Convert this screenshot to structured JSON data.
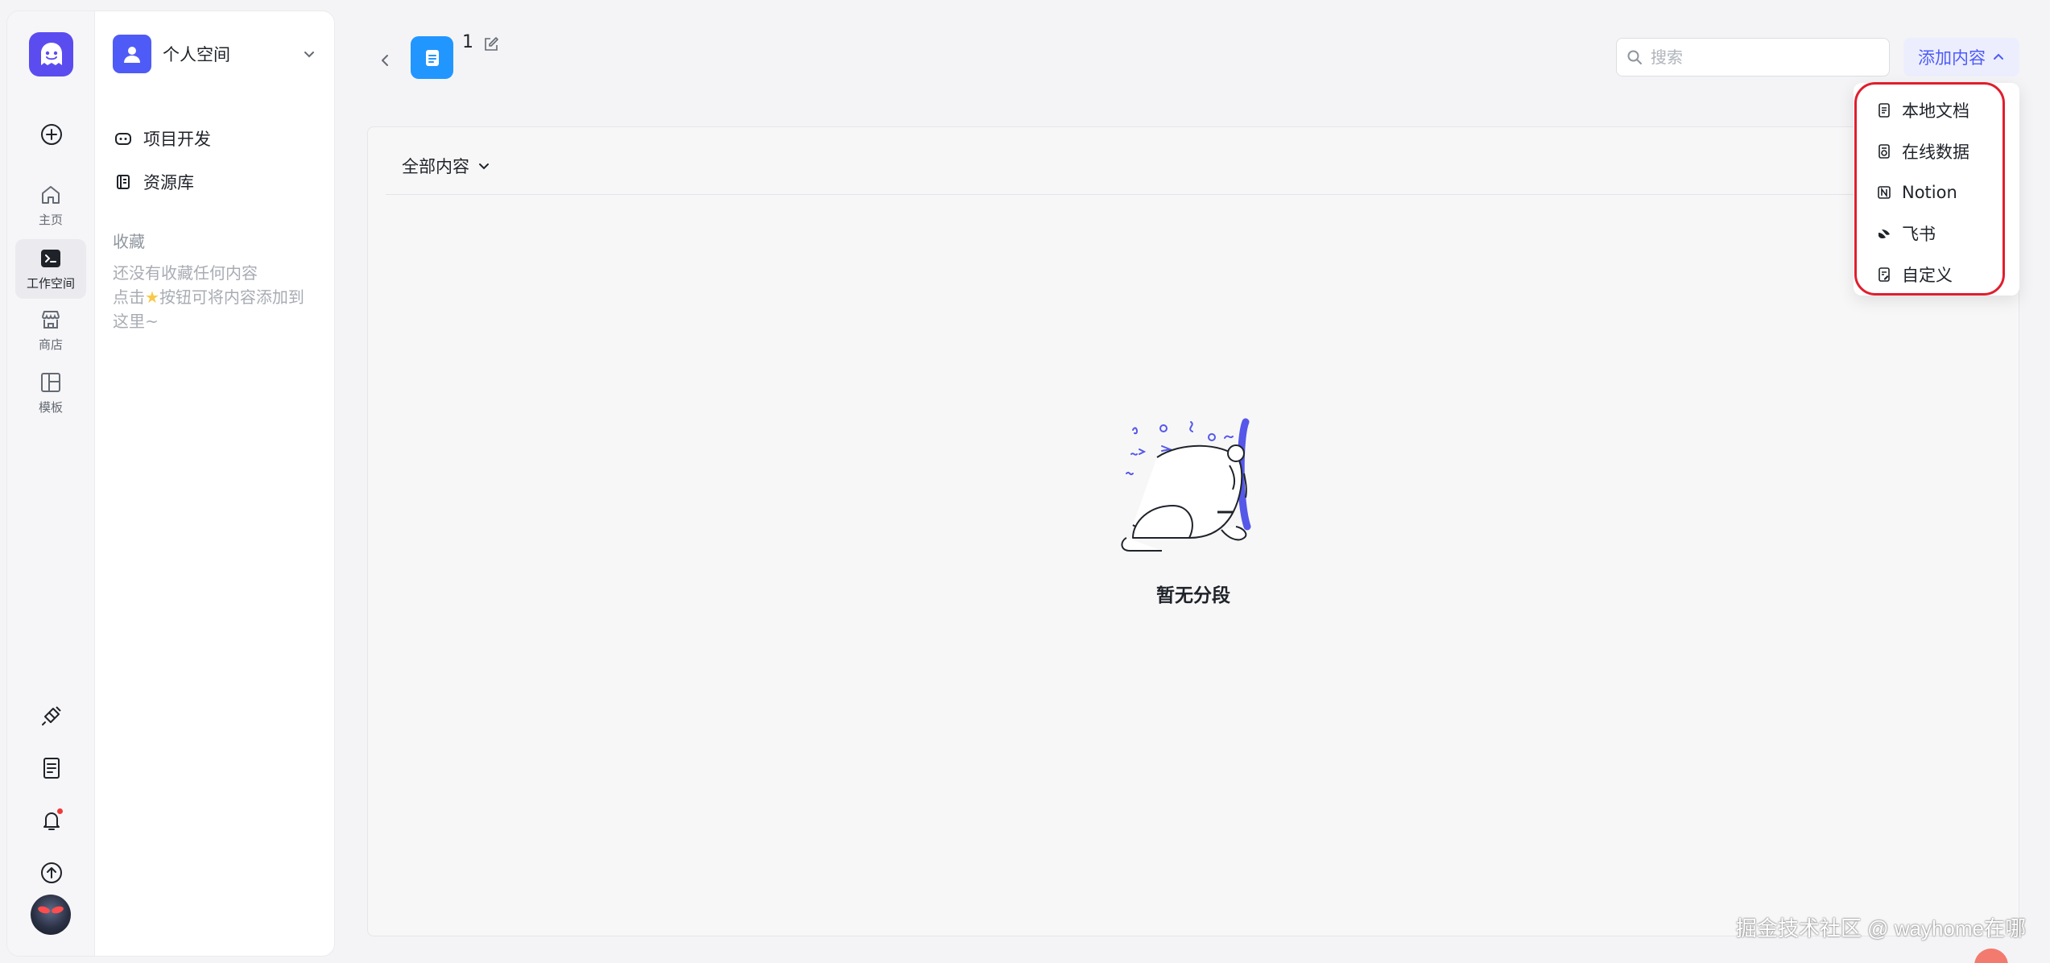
{
  "rail": {
    "home_label": "主页",
    "workspace_label": "工作空间",
    "store_label": "商店",
    "template_label": "模板"
  },
  "sidebar": {
    "space_name": "个人空间",
    "items": [
      {
        "label": "项目开发"
      },
      {
        "label": "资源库"
      }
    ],
    "favorites_title": "收藏",
    "favorites_empty_line1": "还没有收藏任何内容",
    "favorites_empty_line2_pre": "点击",
    "favorites_empty_line2_post": "按钮可将内容添加到",
    "favorites_empty_line3": "这里~"
  },
  "header": {
    "title": "1",
    "search_placeholder": "搜索",
    "add_button_label": "添加内容"
  },
  "panel": {
    "filter_label": "全部内容",
    "empty_text": "暂无分段"
  },
  "dropdown": {
    "items": [
      {
        "label": "本地文档",
        "icon": "file-icon"
      },
      {
        "label": "在线数据",
        "icon": "web-data-icon"
      },
      {
        "label": "Notion",
        "icon": "notion-icon"
      },
      {
        "label": "飞书",
        "icon": "feishu-icon"
      },
      {
        "label": "自定义",
        "icon": "custom-doc-icon"
      }
    ]
  },
  "watermark": "掘金技术社区 @ wayhome在哪",
  "colors": {
    "brand": "#5b4cf0",
    "accent": "#4e5bf7",
    "doc_icon": "#2196ff",
    "highlight": "#e01e2e"
  }
}
